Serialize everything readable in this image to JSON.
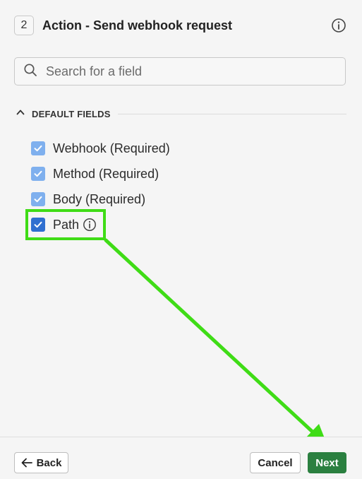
{
  "header": {
    "step_number": "2",
    "title": "Action - Send webhook request"
  },
  "search": {
    "placeholder": "Search for a field",
    "value": ""
  },
  "section": {
    "title": "DEFAULT FIELDS",
    "expanded": true
  },
  "fields": [
    {
      "label": "Webhook (Required)",
      "checked": true,
      "disabled": true
    },
    {
      "label": "Method (Required)",
      "checked": true,
      "disabled": true
    },
    {
      "label": "Body (Required)",
      "checked": true,
      "disabled": true
    },
    {
      "label": "Path",
      "checked": true,
      "disabled": false,
      "has_info": true
    }
  ],
  "footer": {
    "back_label": "Back",
    "cancel_label": "Cancel",
    "next_label": "Next"
  },
  "icons": {
    "step": "step-number-badge",
    "info": "info-icon",
    "search": "search-icon",
    "collapse": "chevron-up-icon",
    "check": "check-icon",
    "back": "arrow-left-icon"
  },
  "colors": {
    "checkbox_disabled": "#7fb0ee",
    "checkbox_active": "#2f6fd0",
    "primary_button": "#2b8040",
    "annotation": "#3fdc16"
  }
}
